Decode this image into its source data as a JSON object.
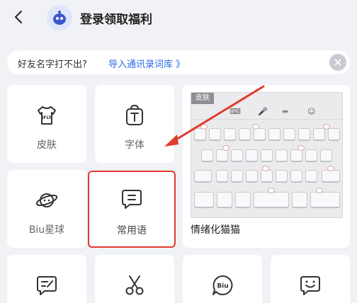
{
  "header": {
    "title": "登录领取福利"
  },
  "banner": {
    "question": "好友名字打不出?",
    "link": "导入通讯录词库 》"
  },
  "tiles": [
    {
      "label": "皮肤",
      "icon": "ifly-tshirt-icon"
    },
    {
      "label": "字体",
      "icon": "font-bag-icon"
    },
    {
      "label": "Biu星球",
      "icon": "planet-icon"
    },
    {
      "label": "常用语",
      "icon": "phrase-bubble-icon"
    }
  ],
  "skin_preview": {
    "badge": "皮肤",
    "name": "情绪化猫猫",
    "toolbar": [
      "⌨",
      "🎤",
      "⇹",
      "☺"
    ]
  },
  "bottom_icons": [
    "edit-note-icon",
    "scissors-icon",
    "biu-bubble-icon",
    "smile-chat-icon"
  ],
  "colors": {
    "accent_red": "#e13b2f",
    "link_blue": "#2b6be6"
  }
}
